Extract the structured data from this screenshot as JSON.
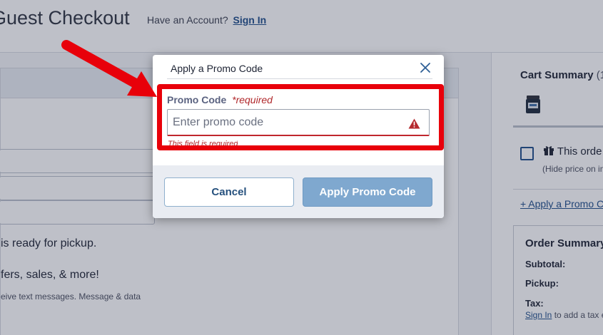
{
  "header": {
    "title": "Guest Checkout",
    "have_account": "Have an Account?",
    "sign_in": "Sign In"
  },
  "form_bg": {
    "pickup_text": "is ready for pickup.",
    "offers_text": "fers, sales, & more!",
    "sms_text": "eive text messages. Message & data"
  },
  "cart": {
    "title": "Cart Summary",
    "count": "(1",
    "gift_label": "This orde",
    "gift_sub": "(Hide price on in",
    "promo_link": "+ Apply a Promo C",
    "order_summary": {
      "title": "Order Summary",
      "subtotal": "Subtotal:",
      "pickup": "Pickup:",
      "tax": "Tax:",
      "tax_link": "Sign In",
      "tax_note": "to add a tax e"
    }
  },
  "modal": {
    "title": "Apply a Promo Code",
    "close_icon": "close-icon",
    "field_label": "Promo Code",
    "field_required": "*required",
    "input_placeholder": "Enter promo code",
    "input_value": "",
    "warning_icon": "warning-triangle-icon",
    "error_text": "This field is required",
    "cancel_label": "Cancel",
    "apply_label": "Apply Promo Code"
  },
  "colors": {
    "accent_blue": "#1f4e8a",
    "apply_button": "#7fa8cf",
    "error_red": "#b0282b",
    "annotation_red": "#e8000a"
  }
}
